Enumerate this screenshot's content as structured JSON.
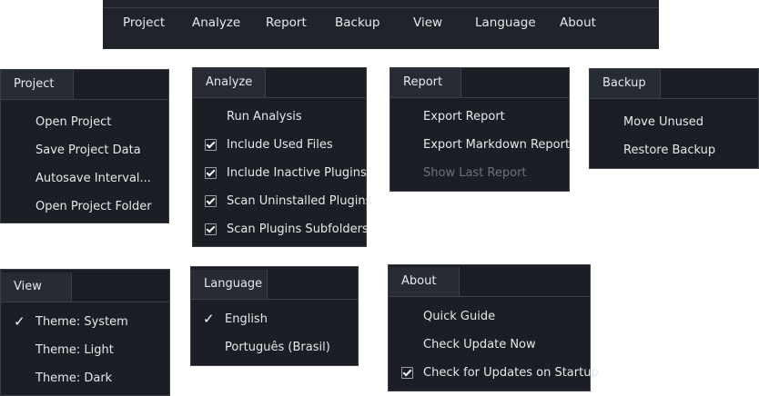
{
  "menubar": {
    "items": [
      "Project",
      "Analyze",
      "Report",
      "Backup",
      "View",
      "Language",
      "About"
    ]
  },
  "menus": {
    "project": {
      "title": "Project",
      "items": [
        "Open Project",
        "Save Project Data",
        "Autosave Interval...",
        "Open Project Folder"
      ]
    },
    "analyze": {
      "title": "Analyze",
      "items": [
        "Run Analysis",
        "Include Used Files",
        "Include Inactive Plugins",
        "Scan Uninstalled Plugins",
        "Scan Plugins Subfolders"
      ],
      "checked": [
        false,
        true,
        true,
        true,
        true
      ]
    },
    "report": {
      "title": "Report",
      "items": [
        "Export Report",
        "Export Markdown Report",
        "Show Last Report"
      ],
      "disabled": [
        false,
        false,
        true
      ]
    },
    "backup": {
      "title": "Backup",
      "items": [
        "Move Unused",
        "Restore Backup"
      ]
    },
    "view": {
      "title": "View",
      "items": [
        "Theme: System",
        "Theme: Light",
        "Theme: Dark"
      ],
      "selected": "Theme: System"
    },
    "language": {
      "title": "Language",
      "items": [
        "English",
        "Português (Brasil)"
      ],
      "selected": "English"
    },
    "about": {
      "title": "About",
      "items": [
        "Quick Guide",
        "Check Update Now",
        "Check for Updates on Startup"
      ],
      "checked": [
        false,
        false,
        true
      ]
    }
  },
  "colors": {
    "bg": "#1b1e24",
    "header": "#272b33",
    "menubar": "#1f232a",
    "border": "#3a3f48",
    "text": "#e6e8ec",
    "disabled": "#6b717b"
  },
  "icons": {
    "checkbox": "checkbox-checked-icon",
    "selection": "check-mark-icon"
  }
}
